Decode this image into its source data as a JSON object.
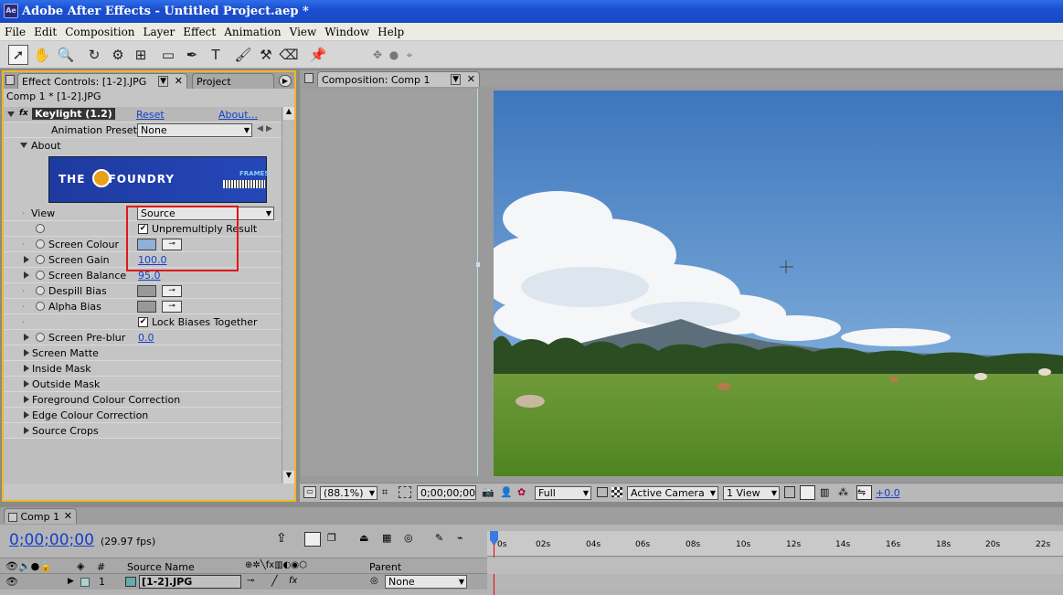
{
  "title_bar": {
    "app_icon": "Ae",
    "title": "Adobe After Effects - Untitled Project.aep *"
  },
  "menu": [
    "File",
    "Edit",
    "Composition",
    "Layer",
    "Effect",
    "Animation",
    "View",
    "Window",
    "Help"
  ],
  "effect_controls": {
    "tab_label": "Effect Controls: [1-2].JPG",
    "project_tab": "Project",
    "breadcrumb": "Comp 1 * [1-2].JPG",
    "effect_name": "Keylight (1.2)",
    "reset": "Reset",
    "about_link": "About...",
    "presets_label": "Animation Presets:",
    "presets_value": "None",
    "about_section": "About",
    "logo_text": "THE FOUNDRY",
    "logo_sub": "FRAMES",
    "view_label": "View",
    "view_value": "Source",
    "unpremultiply": "Unpremultiply Result",
    "screen_colour": "Screen Colour",
    "screen_gain": "Screen Gain",
    "screen_gain_value": "100.0",
    "screen_balance": "Screen Balance",
    "screen_balance_value": "95.0",
    "despill_bias": "Despill Bias",
    "alpha_bias": "Alpha Bias",
    "lock_biases": "Lock Biases Together",
    "screen_preblur": "Screen Pre-blur",
    "screen_preblur_value": "0.0",
    "groups": [
      "Screen Matte",
      "Inside Mask",
      "Outside Mask",
      "Foreground Colour Correction",
      "Edge Colour Correction",
      "Source Crops"
    ]
  },
  "composition": {
    "tab_label": "Composition: Comp 1",
    "zoom": "(88.1%)",
    "timecode": "0;00;00;00",
    "resolution": "Full",
    "camera": "Active Camera",
    "views": "1 View",
    "exposure": "+0.0"
  },
  "timeline": {
    "tab_label": "Comp 1",
    "timecode": "0;00;00;00",
    "fps": "(29.97 fps)",
    "col_num": "#",
    "col_source": "Source Name",
    "col_parent": "Parent",
    "layer_num": "1",
    "layer_name": "[1-2].JPG",
    "parent_value": "None",
    "ruler": [
      "0s",
      "02s",
      "04s",
      "06s",
      "08s",
      "10s",
      "12s",
      "14s",
      "16s",
      "18s",
      "20s",
      "22s"
    ]
  }
}
